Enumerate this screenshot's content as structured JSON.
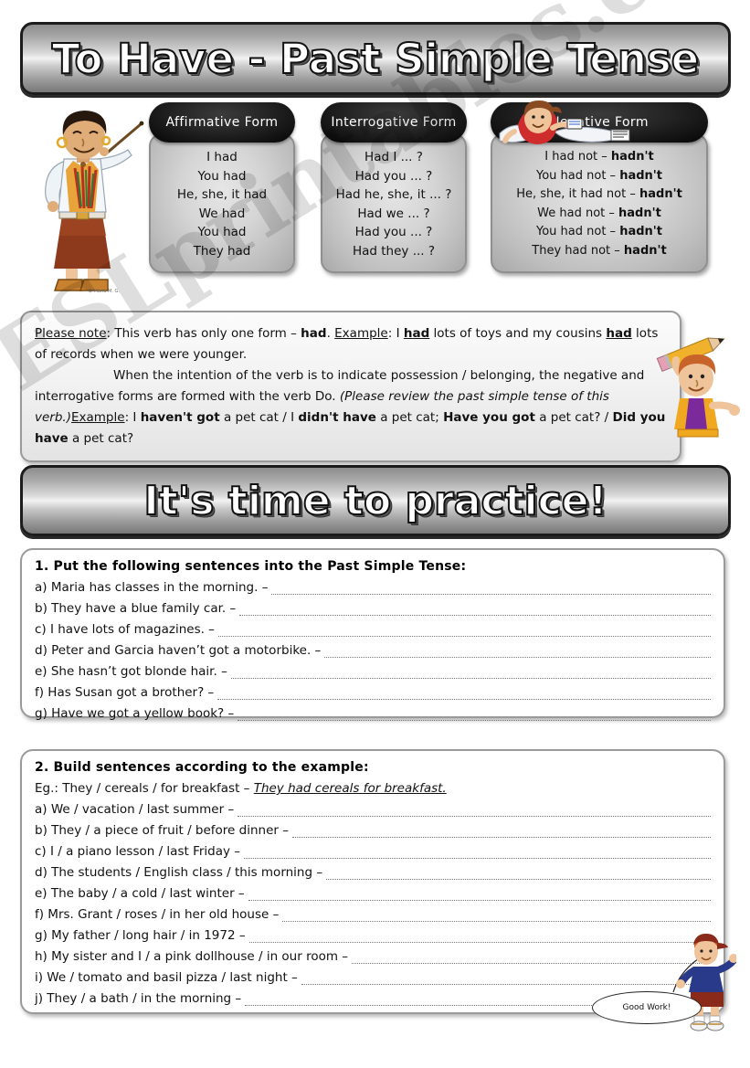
{
  "title_banner": {
    "text": "To Have - Past Simple Tense"
  },
  "practice_banner": {
    "text": "It's time to practice!"
  },
  "forms": [
    {
      "id": "affirmative",
      "header": "Affirmative Form",
      "lines": [
        {
          "plain": "I had",
          "bold": ""
        },
        {
          "plain": "You had",
          "bold": ""
        },
        {
          "plain": "He, she, it had",
          "bold": ""
        },
        {
          "plain": "We had",
          "bold": ""
        },
        {
          "plain": "You had",
          "bold": ""
        },
        {
          "plain": "They had",
          "bold": ""
        }
      ]
    },
    {
      "id": "interrogative",
      "header": "Interrogative Form",
      "lines": [
        {
          "plain": "Had I ... ?",
          "bold": ""
        },
        {
          "plain": "Had you ... ?",
          "bold": ""
        },
        {
          "plain": "Had he, she, it ... ?",
          "bold": ""
        },
        {
          "plain": "Had we ... ?",
          "bold": ""
        },
        {
          "plain": "Had you ... ?",
          "bold": ""
        },
        {
          "plain": "Had they ... ?",
          "bold": ""
        }
      ]
    },
    {
      "id": "negative",
      "header": "Negative Form",
      "lines": [
        {
          "plain": "I had not – ",
          "bold": "hadn't"
        },
        {
          "plain": "You had not – ",
          "bold": "hadn't"
        },
        {
          "plain": "He, she, it had not – ",
          "bold": "hadn't"
        },
        {
          "plain": "We had not – ",
          "bold": "hadn't"
        },
        {
          "plain": "You had not – ",
          "bold": "hadn't"
        },
        {
          "plain": "They had not – ",
          "bold": "hadn't"
        }
      ]
    }
  ],
  "note": {
    "label": "Please note",
    "p1_a": ": This verb has only one form – ",
    "p1_had": "had",
    "p1_b": ". ",
    "example_label_1": "Example",
    "p1_c": ": I ",
    "p1_had2": "had",
    "p1_d": " lots of toys and my cousins ",
    "p1_had3": "had",
    "p1_e": " lots of records when we were younger.",
    "p2_a": "When the intention of the verb is to indicate possession / belonging, the negative and interrogative forms are formed with the verb Do. ",
    "p2_italic": "(Please review the past simple tense of this verb.)",
    "example_label_2": "Example",
    "p2_b": ": I ",
    "p2_bold1": "haven't got",
    "p2_c": " a pet cat / I ",
    "p2_bold2": "didn't have",
    "p2_d": " a pet cat; ",
    "p2_bold3": "Have you got",
    "p2_e": " a pet cat? / ",
    "p2_bold4": "Did you have",
    "p2_f": " a pet cat?"
  },
  "exercise1": {
    "title": "1. Put the following sentences into the Past Simple Tense:",
    "items": [
      "a) Maria has classes in the morning. –",
      "b) They have a blue family car. –",
      "c) I have lots of magazines. –",
      "d) Peter and Garcia haven’t got a motorbike. –",
      "e) She hasn’t got blonde hair. –",
      "f) Has Susan got a brother? –",
      "g) Have we got a yellow book? –"
    ]
  },
  "exercise2": {
    "title": "2. Build sentences according to the example:",
    "example_prompt": "Eg.: They / cereals / for breakfast – ",
    "example_answer": "They had cereals for breakfast.",
    "items": [
      "a) We / vacation / last summer –",
      "b) They / a piece of fruit / before dinner –",
      "c) I / a piano lesson / last Friday –",
      "d) The students / English class / this morning –",
      "e) The baby / a cold / last winter –",
      "f) Mrs. Grant / roses / in her old house –",
      "g) My father / long hair / in 1972 –",
      "h) My sister and I / a pink dollhouse / in our room –",
      "i) We / tomato and basil pizza / last night –",
      "j) They / a bath / in the morning –"
    ]
  },
  "speech_bubble": {
    "text": "Good Work!"
  },
  "watermark": {
    "text": "ESLprintables.com"
  },
  "credit": {
    "text": "© Maria M. G."
  },
  "colors": {
    "banner_dark": "#1c1c1c",
    "card_header": "#111111",
    "card_body": "#cfcfcf",
    "page_bg": "#ffffff",
    "note_bg": "#f0f0f0",
    "dots": "#777777"
  }
}
